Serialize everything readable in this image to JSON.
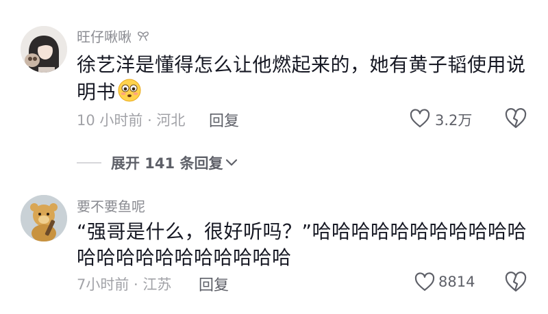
{
  "comments": [
    {
      "username": "旺仔啾啾",
      "text": "徐艺洋是懂得怎么让他燃起来的，她有黄子韬使用说明书",
      "emoji": "flushed-face-emoji",
      "meta": "10 小时前 · 河北",
      "reply_label": "回复",
      "like_count": "3.2万"
    },
    {
      "username": "要不要鱼呢",
      "text": "“强哥是什么，很好听吗？”哈哈哈哈哈哈哈哈哈哈哈哈哈哈哈哈哈哈哈哈哈哈",
      "meta": "7小时前 · 江苏",
      "reply_label": "回复",
      "like_count": "8814"
    }
  ],
  "expand_replies": {
    "label": "展开 141 条回复"
  },
  "icons": {
    "like": "heart-outline-icon",
    "dislike": "broken-heart-outline-icon",
    "expand": "chevron-down-icon",
    "username_badge": "bow-icon"
  },
  "colors": {
    "text": "#161823",
    "meta": "#a1a2a7",
    "username": "#8a8b91",
    "action": "#5e6068"
  }
}
